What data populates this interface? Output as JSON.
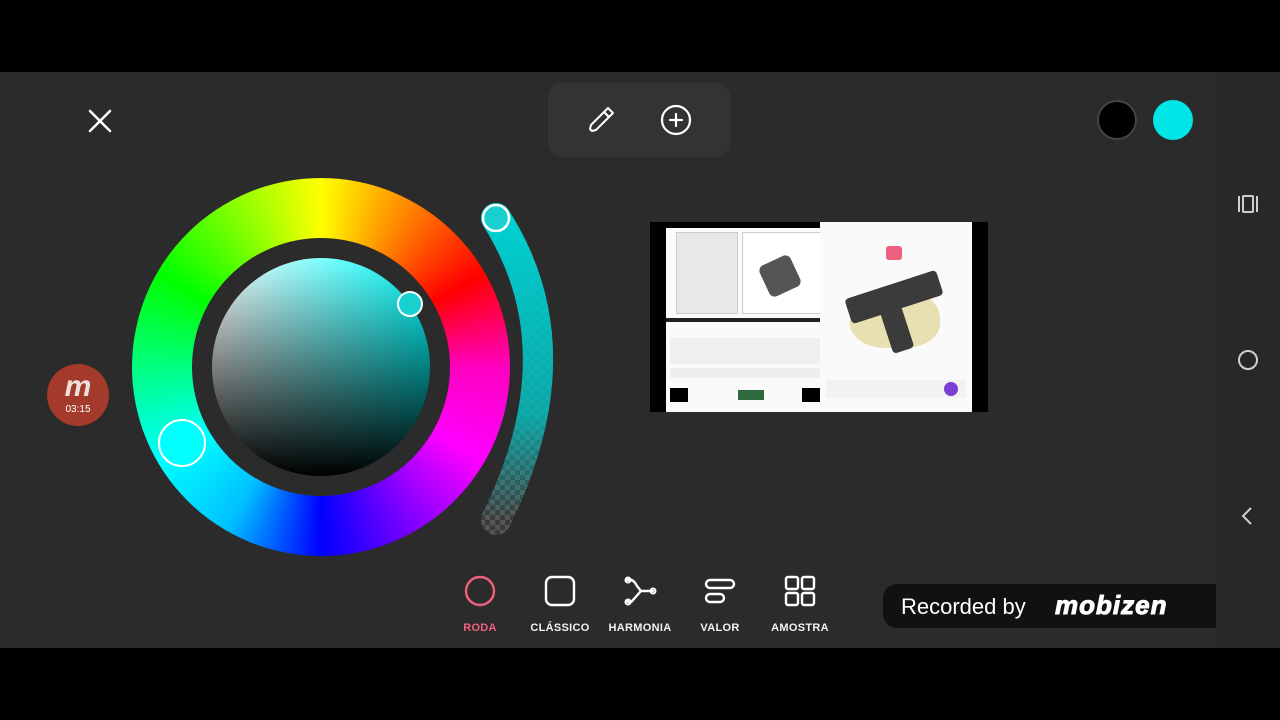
{
  "colors": {
    "primary": "#000000",
    "secondary": "#00e5e5",
    "active_tab": "#f0607e",
    "background": "#2b2b2b"
  },
  "icons": {
    "close": "close-icon",
    "eyedropper": "eyedropper-icon",
    "add": "add-circle-icon"
  },
  "picker": {
    "mode": "RODA",
    "hue_indicator": "cyan"
  },
  "recorder": {
    "logo": "m",
    "time": "03:15"
  },
  "tabs": [
    {
      "label": "RODA",
      "icon": "circle-icon",
      "active": true
    },
    {
      "label": "CLÁSSICO",
      "icon": "square-icon",
      "active": false
    },
    {
      "label": "HARMONIA",
      "icon": "harmony-icon",
      "active": false
    },
    {
      "label": "VALOR",
      "icon": "value-bars-icon",
      "active": false
    },
    {
      "label": "AMOSTRA",
      "icon": "grid-icon",
      "active": false
    }
  ],
  "watermark": {
    "text": "Recorded by",
    "brand": "mobizen"
  },
  "nav": [
    "recent-apps-icon",
    "home-icon",
    "back-icon"
  ]
}
